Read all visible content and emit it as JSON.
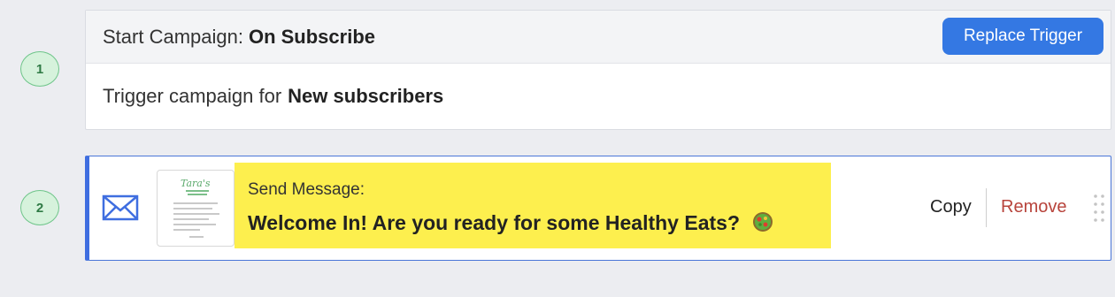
{
  "steps": {
    "one": {
      "number": "1"
    },
    "two": {
      "number": "2"
    }
  },
  "trigger": {
    "header_prefix": "Start Campaign:",
    "header_value": "On Subscribe",
    "replace_button": "Replace Trigger",
    "body_prefix": "Trigger campaign for",
    "body_value": "New subscribers"
  },
  "message": {
    "label": "Send Message:",
    "title": "Welcome In! Are you ready for some Healthy Eats?",
    "thumbnail_logo_text": "Tara's",
    "actions": {
      "copy": "Copy",
      "remove": "Remove"
    }
  },
  "colors": {
    "accent_blue": "#3478e3",
    "step_badge_bg": "#d6f2dc",
    "highlight": "#fdef4e",
    "remove_red": "#b8443c"
  },
  "icons": {
    "message_type": "envelope-icon",
    "title_emoji": "salad-bowl-icon",
    "drag": "drag-handle-icon"
  }
}
